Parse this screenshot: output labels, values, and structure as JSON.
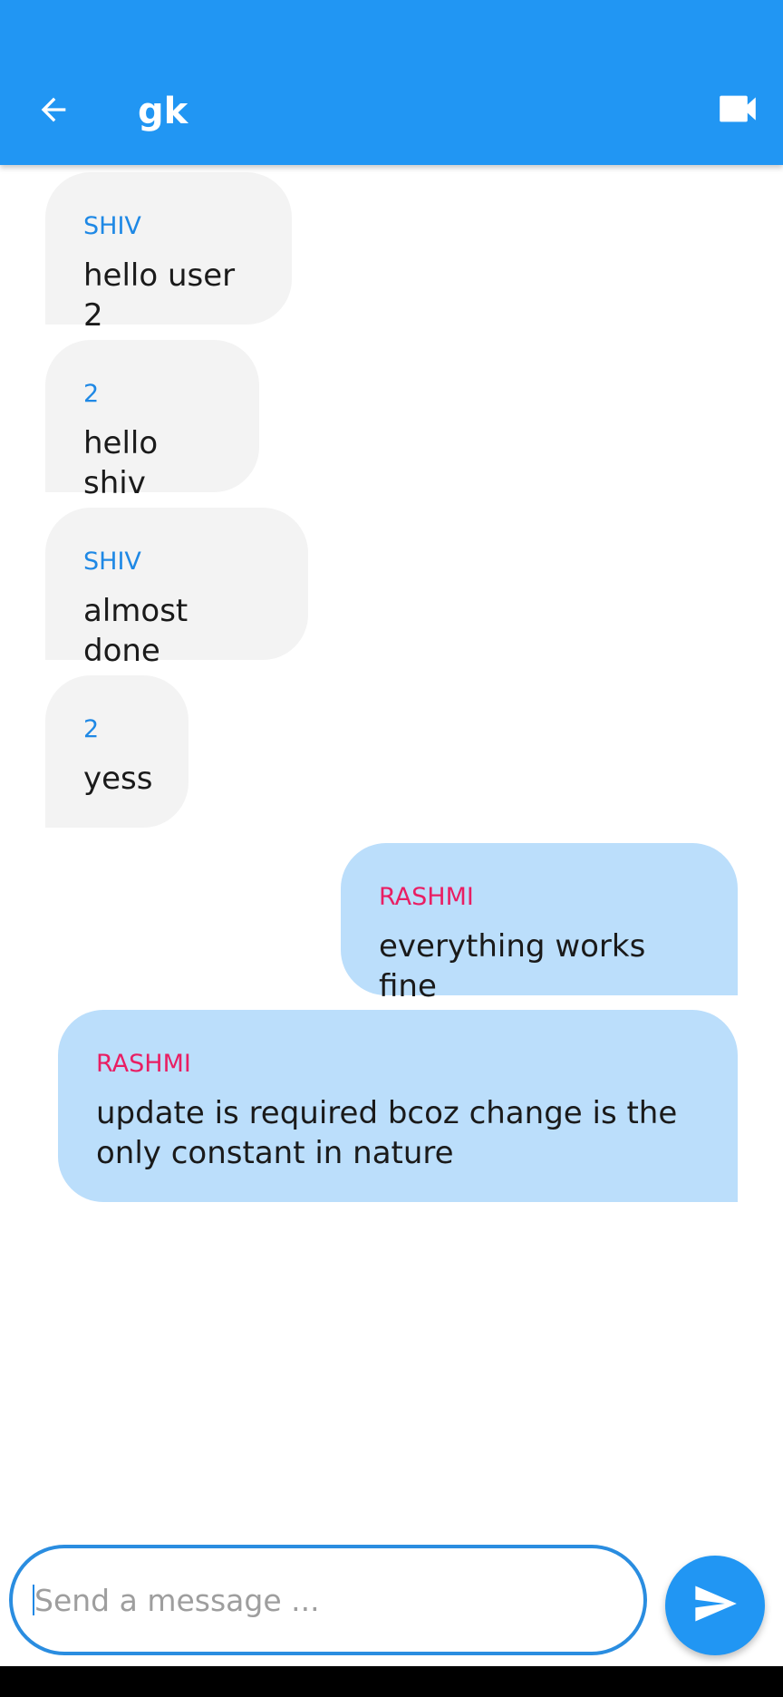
{
  "app_bar": {
    "title": "gk",
    "back_icon": "arrow-left-icon",
    "video_icon": "videocam-icon",
    "color": "#2196f3"
  },
  "messages": [
    {
      "sender": "SHIV",
      "text": "hello user 2",
      "direction": "received"
    },
    {
      "sender": "2",
      "text": "hello shiv",
      "direction": "received"
    },
    {
      "sender": "SHIV",
      "text": "almost done",
      "direction": "received"
    },
    {
      "sender": "2",
      "text": "yess",
      "direction": "received"
    },
    {
      "sender": "RASHMI",
      "text": "everything works fine",
      "direction": "sent"
    },
    {
      "sender": "RASHMI",
      "text_line1": "update is required bcoz change is the",
      "text_line2": "only constant in nature",
      "direction": "sent"
    }
  ],
  "composer": {
    "placeholder": "Send a message ...",
    "value": "",
    "send_icon": "send-icon"
  },
  "colors": {
    "received_bubble": "#f3f3f3",
    "sent_bubble": "#bbdefb",
    "received_sender": "#1e88e5",
    "sent_sender": "#e91e63"
  }
}
